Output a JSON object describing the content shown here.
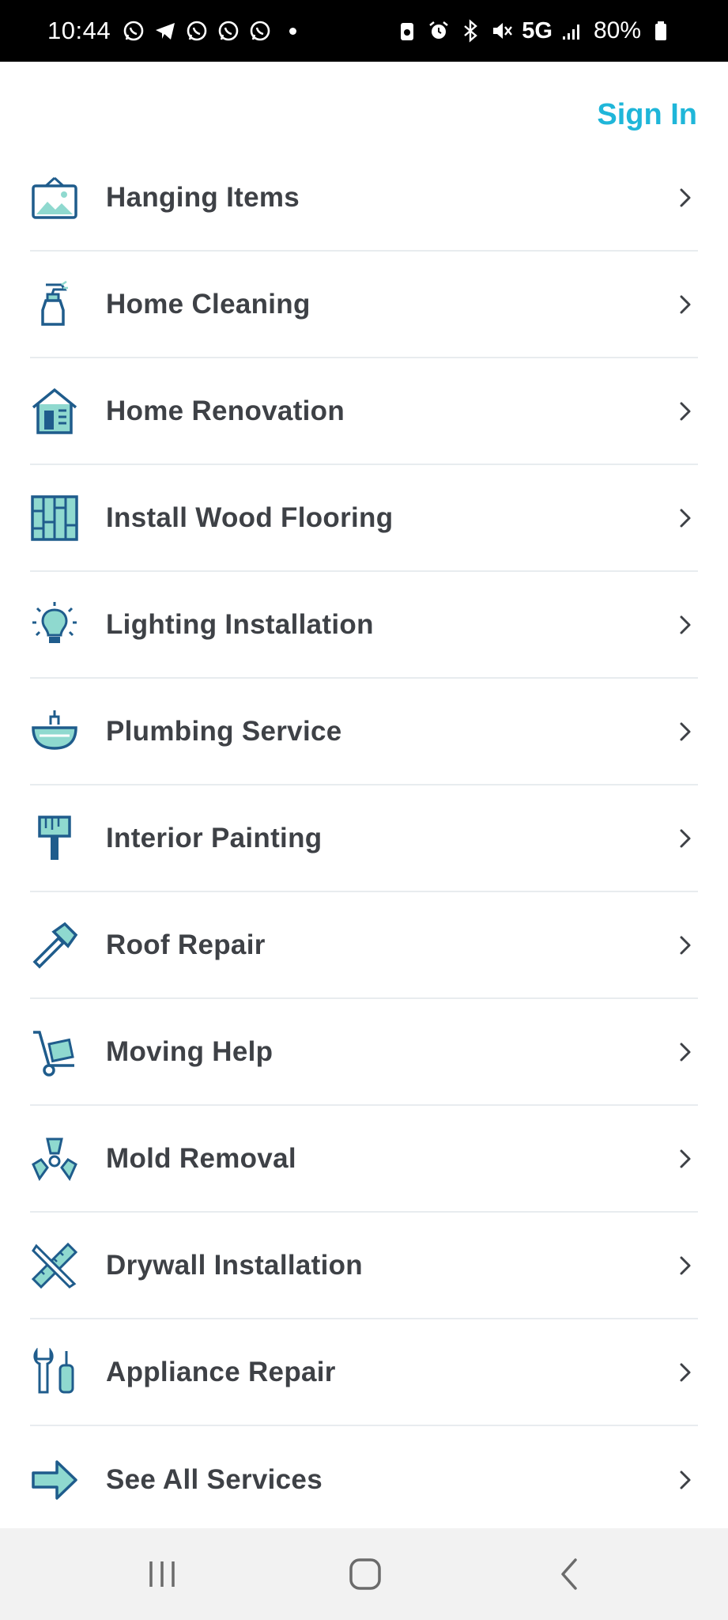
{
  "status_bar": {
    "time": "10:44",
    "network": "5G",
    "battery": "80%"
  },
  "header": {
    "sign_in_label": "Sign In"
  },
  "services": [
    {
      "label": "Hanging Items",
      "icon": "picture-frame-icon"
    },
    {
      "label": "Home Cleaning",
      "icon": "spray-bottle-icon"
    },
    {
      "label": "Home Renovation",
      "icon": "house-icon"
    },
    {
      "label": "Install Wood Flooring",
      "icon": "wood-planks-icon"
    },
    {
      "label": "Lighting Installation",
      "icon": "light-bulb-icon"
    },
    {
      "label": "Plumbing Service",
      "icon": "sink-icon"
    },
    {
      "label": "Interior Painting",
      "icon": "paint-brush-icon"
    },
    {
      "label": "Roof Repair",
      "icon": "hammer-icon"
    },
    {
      "label": "Moving Help",
      "icon": "hand-truck-icon"
    },
    {
      "label": "Mold Removal",
      "icon": "biohazard-icon"
    },
    {
      "label": "Drywall Installation",
      "icon": "ruler-pencil-icon"
    },
    {
      "label": "Appliance Repair",
      "icon": "wrench-screwdriver-icon"
    },
    {
      "label": "See All Services",
      "icon": "arrow-right-icon"
    }
  ],
  "colors": {
    "accent": "#1FB6D9",
    "icon_stroke": "#1F5C8C",
    "icon_fill": "#8FD9CF",
    "text": "#3E4146",
    "divider": "#E8ECEF"
  }
}
